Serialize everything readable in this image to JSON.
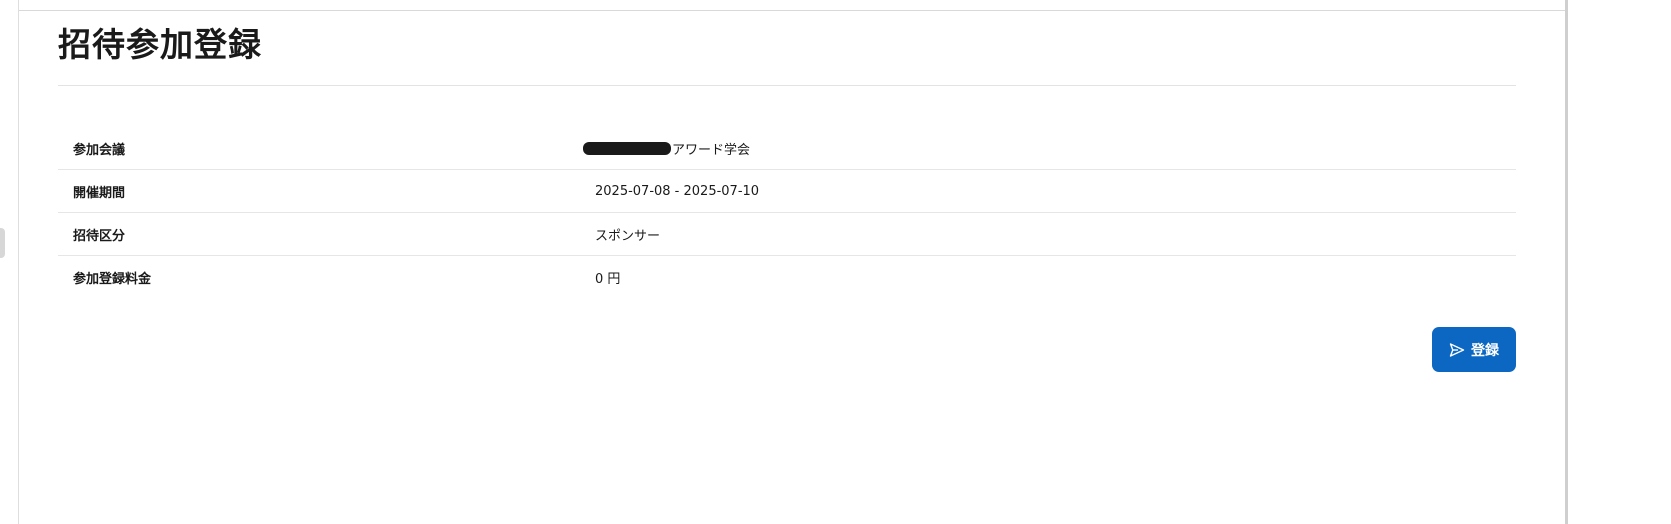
{
  "page": {
    "title": "招待参加登録"
  },
  "info": {
    "rows": [
      {
        "label": "参加会議",
        "value": "アワード学会",
        "redacted_prefix": true
      },
      {
        "label": "開催期間",
        "value": "2025-07-08 - 2025-07-10"
      },
      {
        "label": "招待区分",
        "value": "スポンサー"
      },
      {
        "label": "参加登録料金",
        "value": "0 円"
      }
    ]
  },
  "actions": {
    "register_label": "登録",
    "register_icon": "send-icon"
  },
  "colors": {
    "primary": "#0b67c2",
    "highlight": "#fbe7a1",
    "divider": "#e6e6e6"
  }
}
